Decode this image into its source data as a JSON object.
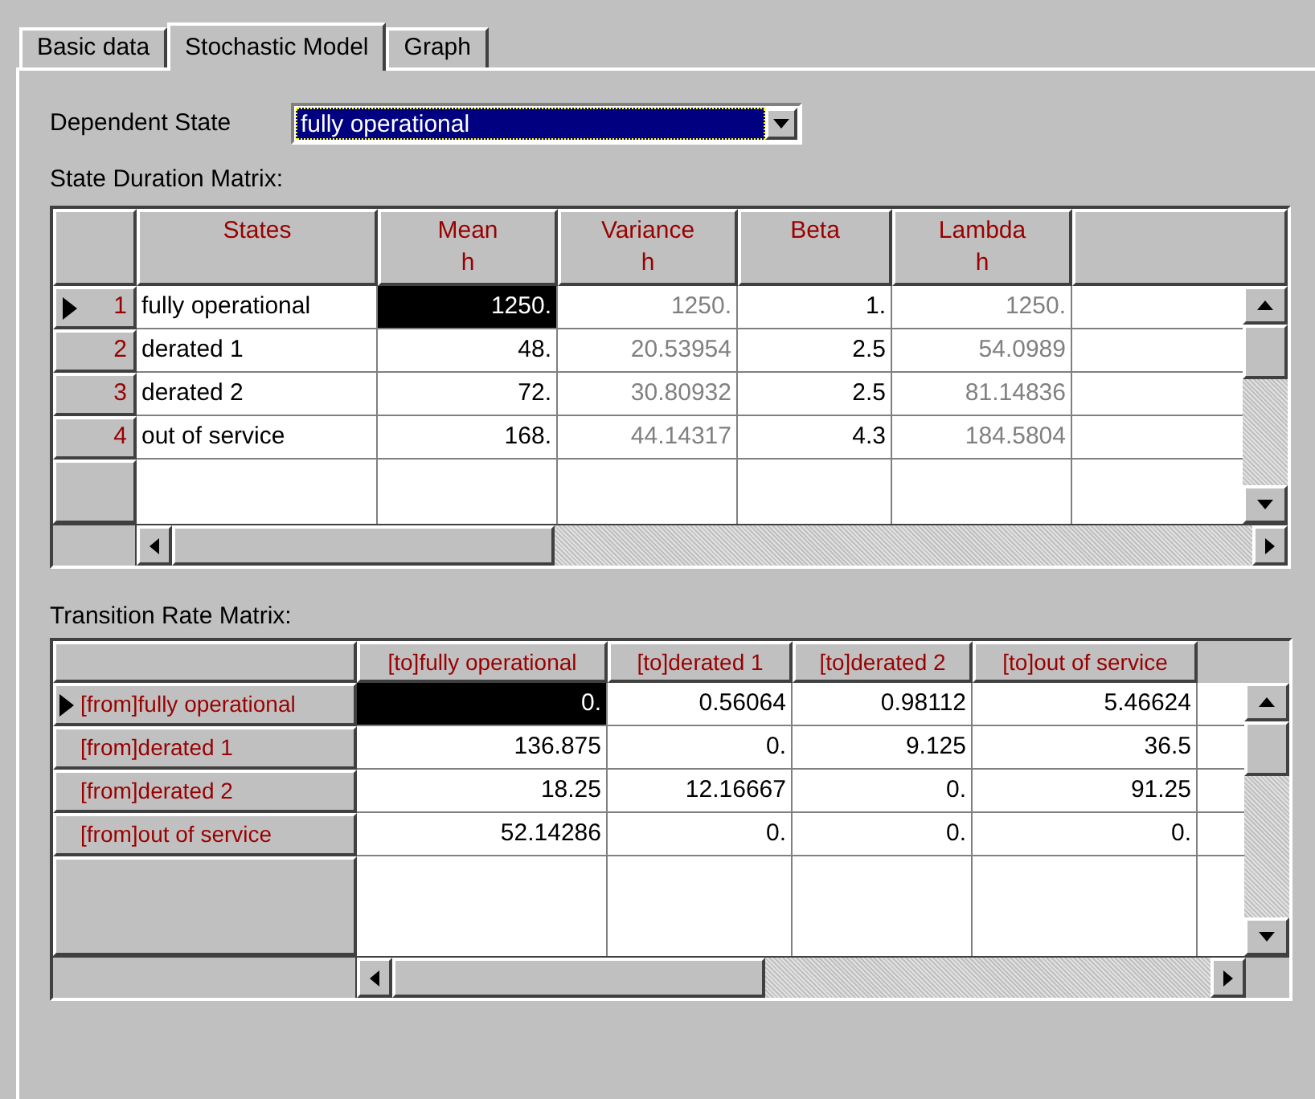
{
  "tabs": [
    {
      "label": "Basic data",
      "selected": false
    },
    {
      "label": "Stochastic Model",
      "selected": true
    },
    {
      "label": "Graph",
      "selected": false
    }
  ],
  "dependent_state": {
    "label": "Dependent State",
    "value": "fully operational"
  },
  "duration_matrix": {
    "title": "State Duration Matrix:",
    "columns": [
      {
        "label": "States",
        "readonly": false
      },
      {
        "label": "Mean",
        "unit": "h",
        "readonly": false
      },
      {
        "label": "Variance",
        "unit": "h",
        "readonly": true
      },
      {
        "label": "Beta",
        "readonly": false
      },
      {
        "label": "Lambda",
        "unit": "h",
        "readonly": true
      }
    ],
    "rows": [
      {
        "number": "1",
        "current": true,
        "cells": [
          {
            "text": "fully operational",
            "selected": false
          },
          {
            "text": "1250.",
            "selected": true
          },
          {
            "text": "1250.",
            "selected": false
          },
          {
            "text": "1.",
            "selected": false
          },
          {
            "text": "1250.",
            "selected": false
          }
        ]
      },
      {
        "number": "2",
        "current": false,
        "cells": [
          {
            "text": "derated 1",
            "selected": false
          },
          {
            "text": "48.",
            "selected": false
          },
          {
            "text": "20.53954",
            "selected": false
          },
          {
            "text": "2.5",
            "selected": false
          },
          {
            "text": "54.0989",
            "selected": false
          }
        ]
      },
      {
        "number": "3",
        "current": false,
        "cells": [
          {
            "text": "derated 2",
            "selected": false
          },
          {
            "text": "72.",
            "selected": false
          },
          {
            "text": "30.80932",
            "selected": false
          },
          {
            "text": "2.5",
            "selected": false
          },
          {
            "text": "81.14836",
            "selected": false
          }
        ]
      },
      {
        "number": "4",
        "current": false,
        "cells": [
          {
            "text": "out of service",
            "selected": false
          },
          {
            "text": "168.",
            "selected": false
          },
          {
            "text": "44.14317",
            "selected": false
          },
          {
            "text": "4.3",
            "selected": false
          },
          {
            "text": "184.5804",
            "selected": false
          }
        ]
      }
    ]
  },
  "transition_matrix": {
    "title": "Transition Rate Matrix:",
    "columns": [
      "[to]fully operational",
      "[to]derated 1",
      "[to]derated 2",
      "[to]out of service"
    ],
    "rows": [
      {
        "label": "[from]fully operational",
        "current": true,
        "cells": [
          {
            "text": "0.",
            "selected": true
          },
          {
            "text": "0.56064",
            "selected": false
          },
          {
            "text": "0.98112",
            "selected": false
          },
          {
            "text": "5.46624",
            "selected": false
          }
        ]
      },
      {
        "label": "[from]derated 1",
        "current": false,
        "cells": [
          {
            "text": "136.875",
            "selected": false
          },
          {
            "text": "0.",
            "selected": false
          },
          {
            "text": "9.125",
            "selected": false
          },
          {
            "text": "36.5",
            "selected": false
          }
        ]
      },
      {
        "label": "[from]derated 2",
        "current": false,
        "cells": [
          {
            "text": "18.25",
            "selected": false
          },
          {
            "text": "12.16667",
            "selected": false
          },
          {
            "text": "0.",
            "selected": false
          },
          {
            "text": "91.25",
            "selected": false
          }
        ]
      },
      {
        "label": "[from]out of service",
        "current": false,
        "cells": [
          {
            "text": "52.14286",
            "selected": false
          },
          {
            "text": "0.",
            "selected": false
          },
          {
            "text": "0.",
            "selected": false
          },
          {
            "text": "0.",
            "selected": false
          }
        ]
      }
    ]
  }
}
